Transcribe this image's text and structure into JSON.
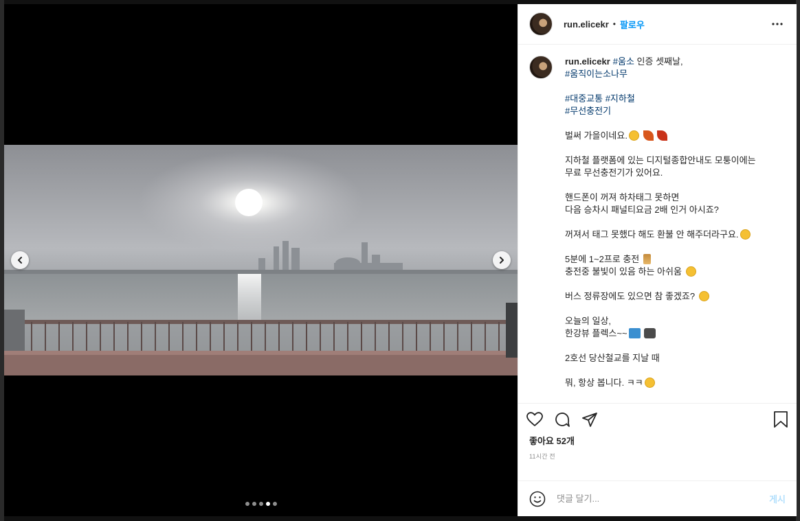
{
  "post": {
    "username": "run.elicekr",
    "separator": "•",
    "follow_label": "팔로우",
    "more_icon": "more-horizontal-icon"
  },
  "caption": {
    "username": "run.elicekr",
    "line1_tag": "#움소",
    "line1_text": " 인증 셋째날,",
    "line2_tag": "#움직이는소나무",
    "line3_tag_a": "#대중교통",
    "line3_tag_b": "#지하철",
    "line4_tag": "#무선충전기",
    "l_autumn": "벌써 가을이네요.",
    "l_platform1": "지하철 플랫폼에 있는 디지털종합안내도 모퉁이에는",
    "l_platform2": "무료 무선충전기가 있어요.",
    "l_phone1": "핸드폰이 꺼져 하차태그 못하면",
    "l_phone2": "다음 승차시 패널티요금 2배 인거 아시죠?",
    "l_refund": "꺼져서 태그 못했다 해도 환불 안 해주더라구요.",
    "l_charge": "5분에 1~2프로 충전",
    "l_light": "충전중 불빛이 있음 하는 아쉬움",
    "l_bus": "버스 정류장에도 있으면 참 좋겠죠?",
    "l_today": "오늘의 일상,",
    "l_view": "한강뷰 플렉스~~",
    "l_line2": "2호선 당산철교를 지날 때",
    "l_always": "뭐, 항상 봅니다. ㅋㅋ"
  },
  "actions": {
    "like_icon": "heart-icon",
    "comment_icon": "comment-icon",
    "share_icon": "share-icon",
    "save_icon": "bookmark-icon"
  },
  "likes_text": "좋아요 52개",
  "timestamp": "11시간 전",
  "comment": {
    "placeholder": "댓글 달기...",
    "post_label": "게시"
  },
  "carousel": {
    "slide_count": 5,
    "active_index": 3
  },
  "colors": {
    "link": "#0095f6",
    "hashtag": "#00376b",
    "post_disabled": "#b2dffc"
  }
}
